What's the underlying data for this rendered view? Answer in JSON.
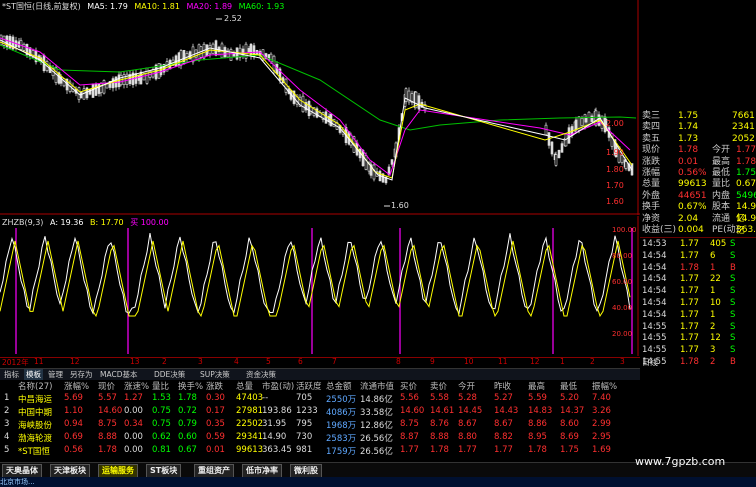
{
  "kline": {
    "title": "*ST国恒(日线,前复权)",
    "ma_legend": [
      {
        "label": "MA5: 1.79",
        "color": "#ffffff"
      },
      {
        "label": "MA10: 1.81",
        "color": "#ffff00"
      },
      {
        "label": "MA20: 1.89",
        "color": "#ff00ff"
      },
      {
        "label": "MA60: 1.93",
        "color": "#00ff00"
      }
    ],
    "high_marker": "2.52",
    "low_marker": "1.60",
    "price_axis": [
      "2.00",
      "1.90",
      "1.80",
      "1.70",
      "1.60"
    ]
  },
  "osc": {
    "title": "ZHZB(9,3)",
    "legend": [
      {
        "label": "A: 19.36",
        "color": "#ffffff"
      },
      {
        "label": "B: 17.70",
        "color": "#ffff00"
      },
      {
        "label": "买 100.00",
        "color": "#ff00ff"
      }
    ],
    "axis": [
      "100.00",
      "80.00",
      "60.00",
      "40.00",
      "20.00"
    ]
  },
  "time_axis": {
    "labels": [
      "2012年",
      "11",
      "12",
      "13",
      "2",
      "3",
      "4",
      "5",
      "6",
      "7",
      "8",
      "9",
      "10",
      "11",
      "12",
      "1",
      "2",
      "3"
    ],
    "side_label": "日线"
  },
  "quote": {
    "rows": [
      {
        "k1": "卖三",
        "v1": "1.75",
        "v2": "7661",
        "c1": "#ffff00",
        "c2": "#ffff00"
      },
      {
        "k1": "卖四",
        "v1": "1.74",
        "v2": "2341",
        "c1": "#ffff00",
        "c2": "#ffff00"
      },
      {
        "k1": "卖五",
        "v1": "1.73",
        "v2": "2052",
        "c1": "#ffff00",
        "c2": "#ffff00"
      },
      {
        "k1": "现价",
        "v1": "1.78",
        "k2": "今开",
        "v2": "1.77",
        "c1": "#ff3030",
        "c2": "#ff3030"
      },
      {
        "k1": "涨跌",
        "v1": "0.01",
        "k2": "最高",
        "v2": "1.78",
        "c1": "#ff3030",
        "c2": "#ff3030"
      },
      {
        "k1": "涨幅",
        "v1": "0.56%",
        "k2": "最低",
        "v2": "1.75",
        "c1": "#ff3030",
        "c2": "#00ff00"
      },
      {
        "k1": "总量",
        "v1": "99613",
        "k2": "量比",
        "v2": "0.67",
        "c1": "#ffff00",
        "c2": "#ffff00"
      },
      {
        "k1": "外盘",
        "v1": "44651",
        "k2": "内盘",
        "v2": "54962",
        "c1": "#ff3030",
        "c2": "#00ff00"
      },
      {
        "k1": "换手",
        "v1": "0.67%",
        "k2": "股本",
        "v2": "14.9亿",
        "c1": "#ffff00",
        "c2": "#ffff00"
      },
      {
        "k1": "净资",
        "v1": "2.04",
        "k2": "流通",
        "v2": "14.9亿",
        "c1": "#ffff00",
        "c2": "#ffff00"
      },
      {
        "k1": "收益(三)",
        "v1": "0.004",
        "k2": "PE(动)",
        "v2": "363.5",
        "c1": "#ffff00",
        "c2": "#ffff00"
      }
    ]
  },
  "ticks": [
    {
      "time": "14:53",
      "price": "1.77",
      "vol": "405",
      "side": "S",
      "vc": "#ffff00",
      "sc": "#00ff00"
    },
    {
      "time": "14:54",
      "price": "1.77",
      "vol": "6",
      "side": "S",
      "vc": "#ffff00",
      "sc": "#00ff00"
    },
    {
      "time": "14:54",
      "price": "1.78",
      "vol": "1",
      "side": "B",
      "vc": "#ff3030",
      "sc": "#ff3030"
    },
    {
      "time": "14:54",
      "price": "1.77",
      "vol": "22",
      "side": "S",
      "vc": "#ffff00",
      "sc": "#00ff00"
    },
    {
      "time": "14:54",
      "price": "1.77",
      "vol": "1",
      "side": "S",
      "vc": "#ffff00",
      "sc": "#00ff00"
    },
    {
      "time": "14:54",
      "price": "1.77",
      "vol": "10",
      "side": "S",
      "vc": "#ffff00",
      "sc": "#00ff00"
    },
    {
      "time": "14:54",
      "price": "1.77",
      "vol": "1",
      "side": "S",
      "vc": "#ffff00",
      "sc": "#00ff00"
    },
    {
      "time": "14:55",
      "price": "1.77",
      "vol": "2",
      "side": "S",
      "vc": "#ffff00",
      "sc": "#00ff00"
    },
    {
      "time": "14:55",
      "price": "1.77",
      "vol": "12",
      "side": "S",
      "vc": "#ffff00",
      "sc": "#00ff00"
    },
    {
      "time": "14:55",
      "price": "1.77",
      "vol": "3",
      "side": "S",
      "vc": "#ffff00",
      "sc": "#00ff00"
    },
    {
      "time": "14:55",
      "price": "1.78",
      "vol": "2",
      "side": "B",
      "vc": "#ff3030",
      "sc": "#ff3030"
    }
  ],
  "toolbar": {
    "items": [
      {
        "label": "指标",
        "active": false
      },
      {
        "label": "模板",
        "active": true
      },
      {
        "label": "管理",
        "active": false
      },
      {
        "label": "另存为",
        "active": false
      },
      {
        "label": "MACD基本",
        "active": false
      },
      {
        "label": "DDE决策",
        "active": false
      },
      {
        "label": "SUP决策",
        "active": false
      },
      {
        "label": "资金决策",
        "active": false
      }
    ]
  },
  "table": {
    "headers": [
      "名称(27)",
      "涨幅%",
      "现价",
      "涨速%",
      "量比",
      "换手%",
      "涨跌",
      "总量",
      "市盈(动)",
      "活跃度",
      "总金额",
      "流通市值",
      "买价",
      "卖价",
      "今开",
      "昨收",
      "最高",
      "最低",
      "振幅%"
    ],
    "rows": [
      {
        "idx": "1",
        "name": "中昌海运",
        "cells": [
          "5.69",
          "5.57",
          "1.27",
          "1.53",
          "1.78",
          "0.30",
          "47403",
          "--",
          "705",
          "2550万",
          "14.86亿",
          "5.56",
          "5.58",
          "5.28",
          "5.27",
          "5.59",
          "5.20",
          "7.40"
        ]
      },
      {
        "idx": "2",
        "name": "中国中期",
        "cells": [
          "1.10",
          "14.60",
          "0.00",
          "0.75",
          "0.72",
          "0.17",
          "27981",
          "193.86",
          "1233",
          "4086万",
          "33.58亿",
          "14.60",
          "14.61",
          "14.45",
          "14.43",
          "14.83",
          "14.37",
          "3.26"
        ]
      },
      {
        "idx": "3",
        "name": "海峡股份",
        "cells": [
          "0.94",
          "8.75",
          "0.34",
          "0.75",
          "0.79",
          "0.35",
          "22502",
          "31.95",
          "795",
          "1968万",
          "12.86亿",
          "8.75",
          "8.76",
          "8.67",
          "8.67",
          "8.86",
          "8.60",
          "2.99"
        ]
      },
      {
        "idx": "4",
        "name": "渤海轮渡",
        "cells": [
          "0.69",
          "8.88",
          "0.00",
          "0.62",
          "0.60",
          "0.59",
          "29341",
          "14.90",
          "730",
          "2583万",
          "26.56亿",
          "8.87",
          "8.88",
          "8.80",
          "8.82",
          "8.95",
          "8.69",
          "2.95"
        ]
      },
      {
        "idx": "5",
        "name": "*ST国恒",
        "cells": [
          "0.56",
          "1.78",
          "0.00",
          "0.81",
          "0.67",
          "0.01",
          "99613",
          "363.45",
          "981",
          "1759万",
          "26.56亿",
          "1.77",
          "1.78",
          "1.77",
          "1.77",
          "1.78",
          "1.75",
          "1.69"
        ]
      }
    ]
  },
  "bottom_tabs": [
    {
      "label": "天奥晶体",
      "active": false
    },
    {
      "label": "天津板块",
      "active": false
    },
    {
      "label": "运输服务",
      "active": true
    },
    {
      "label": "ST板块",
      "active": false
    },
    {
      "label": "重组资产",
      "active": false
    },
    {
      "label": "低市净率",
      "active": false
    },
    {
      "label": "微利股",
      "active": false
    }
  ],
  "status_text": "北京市场...",
  "watermark": "www.7gpzb.com"
}
